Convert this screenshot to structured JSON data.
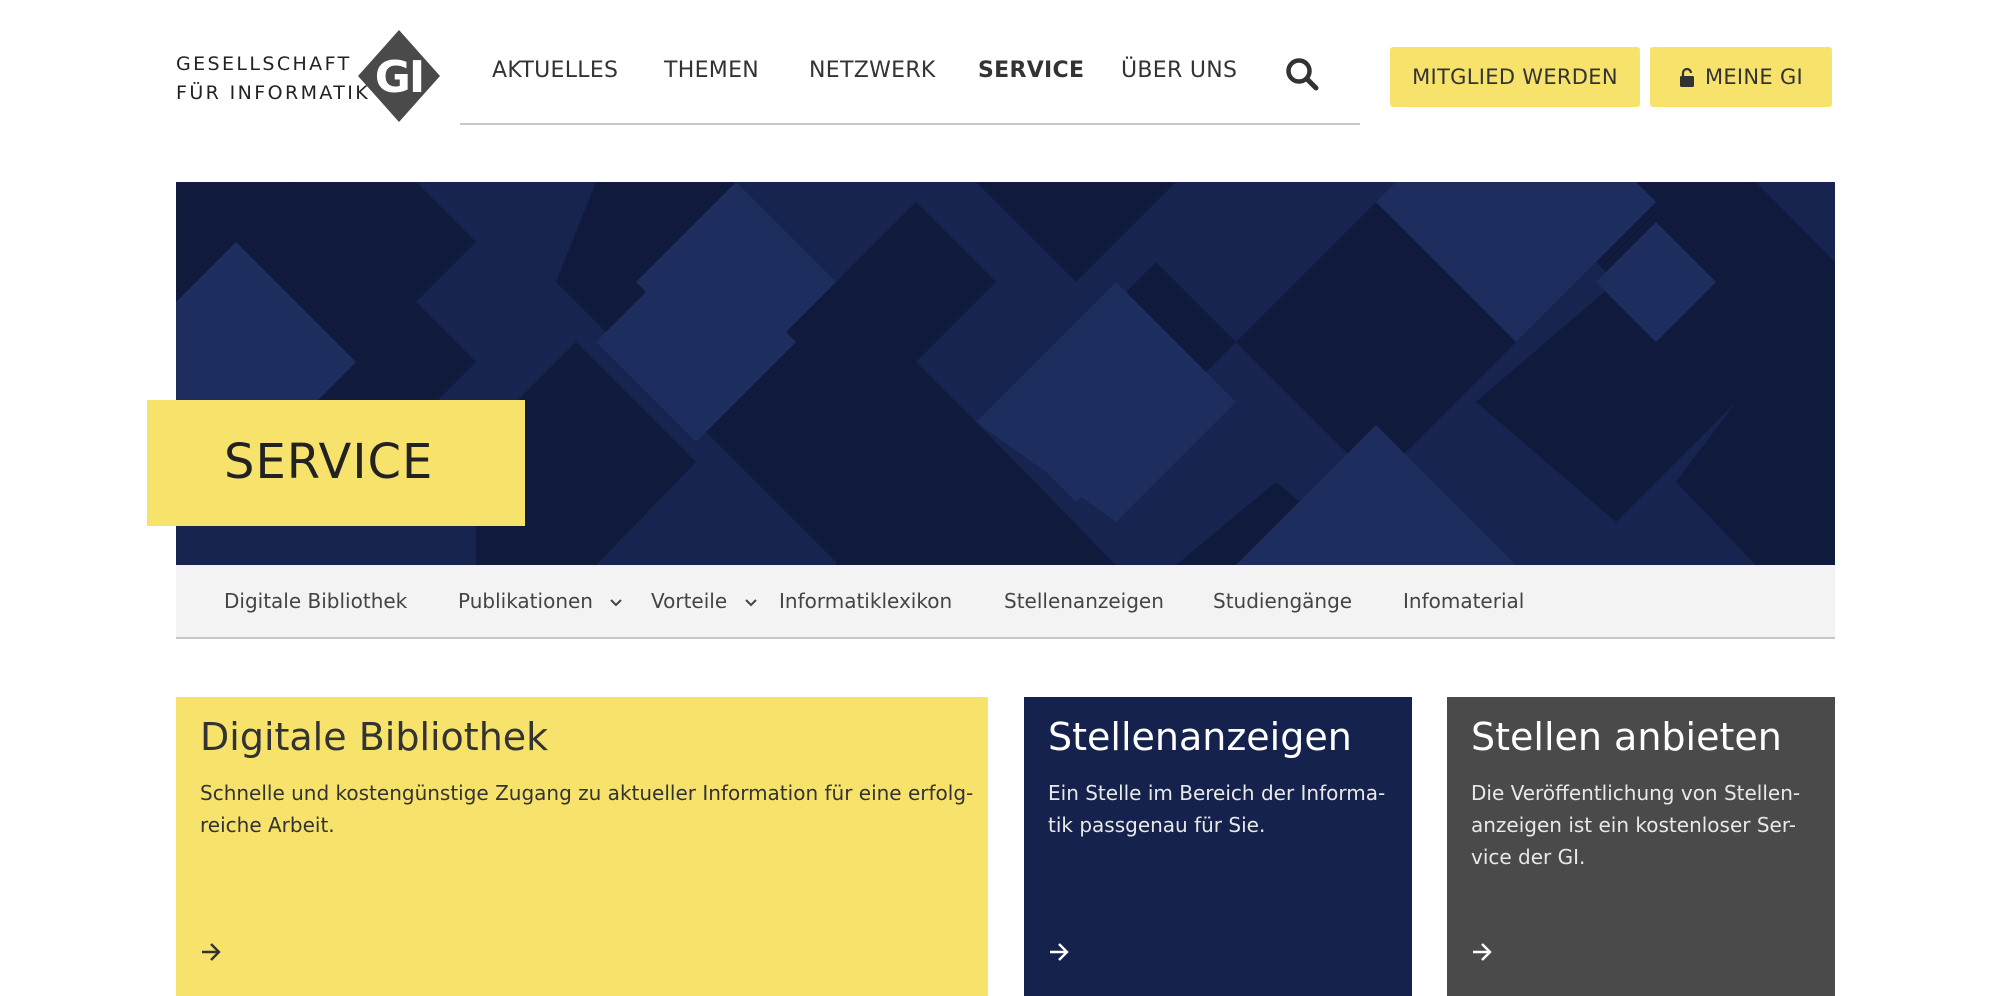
{
  "logo": {
    "line1": "GESELLSCHAFT",
    "line2": "FÜR INFORMATIK",
    "mark_text": "GI"
  },
  "nav": {
    "items": [
      {
        "label": "AKTUELLES",
        "active": false
      },
      {
        "label": "THEMEN",
        "active": false
      },
      {
        "label": "NETZWERK",
        "active": false
      },
      {
        "label": "SERVICE",
        "active": true
      },
      {
        "label": "ÜBER UNS",
        "active": false
      }
    ],
    "search_icon": "search-icon"
  },
  "buttons": {
    "member": "MITGLIED WERDEN",
    "meine_gi": "MEINE GI",
    "meine_gi_icon": "lock-icon"
  },
  "hero": {
    "title": "SERVICE"
  },
  "subnav": {
    "items": [
      {
        "label": "Digitale Bibliothek",
        "dropdown": false
      },
      {
        "label": "Publikationen",
        "dropdown": true
      },
      {
        "label": "Vorteile",
        "dropdown": true
      },
      {
        "label": "Informatiklexikon",
        "dropdown": false
      },
      {
        "label": "Stellenanzeigen",
        "dropdown": false
      },
      {
        "label": "Studiengänge",
        "dropdown": false
      },
      {
        "label": "Infomaterial",
        "dropdown": false
      }
    ]
  },
  "cards": [
    {
      "title": "Digitale Bibliothek",
      "desc_lines": [
        "Schnelle und kostengünstige Zugang zu aktueller Information für eine erfolg-",
        "reiche Arbeit."
      ],
      "arrow_icon": "arrow-right-icon"
    },
    {
      "title": "Stellenanzeigen",
      "desc_lines": [
        "Ein Stelle im Bereich der Informa-",
        "tik passgenau für Sie."
      ],
      "arrow_icon": "arrow-right-icon"
    },
    {
      "title": "Stellen anbieten",
      "desc_lines": [
        "Die Veröffentlichung von Stellen-",
        "anzeigen ist ein kostenloser Ser-",
        "vice der GI."
      ],
      "arrow_icon": "arrow-right-icon"
    }
  ],
  "colors": {
    "accent_yellow": "#f7e36c",
    "navy": "#15224d",
    "dark_grey": "#4a4a4a",
    "subnav_bg": "#f3f3f3"
  }
}
